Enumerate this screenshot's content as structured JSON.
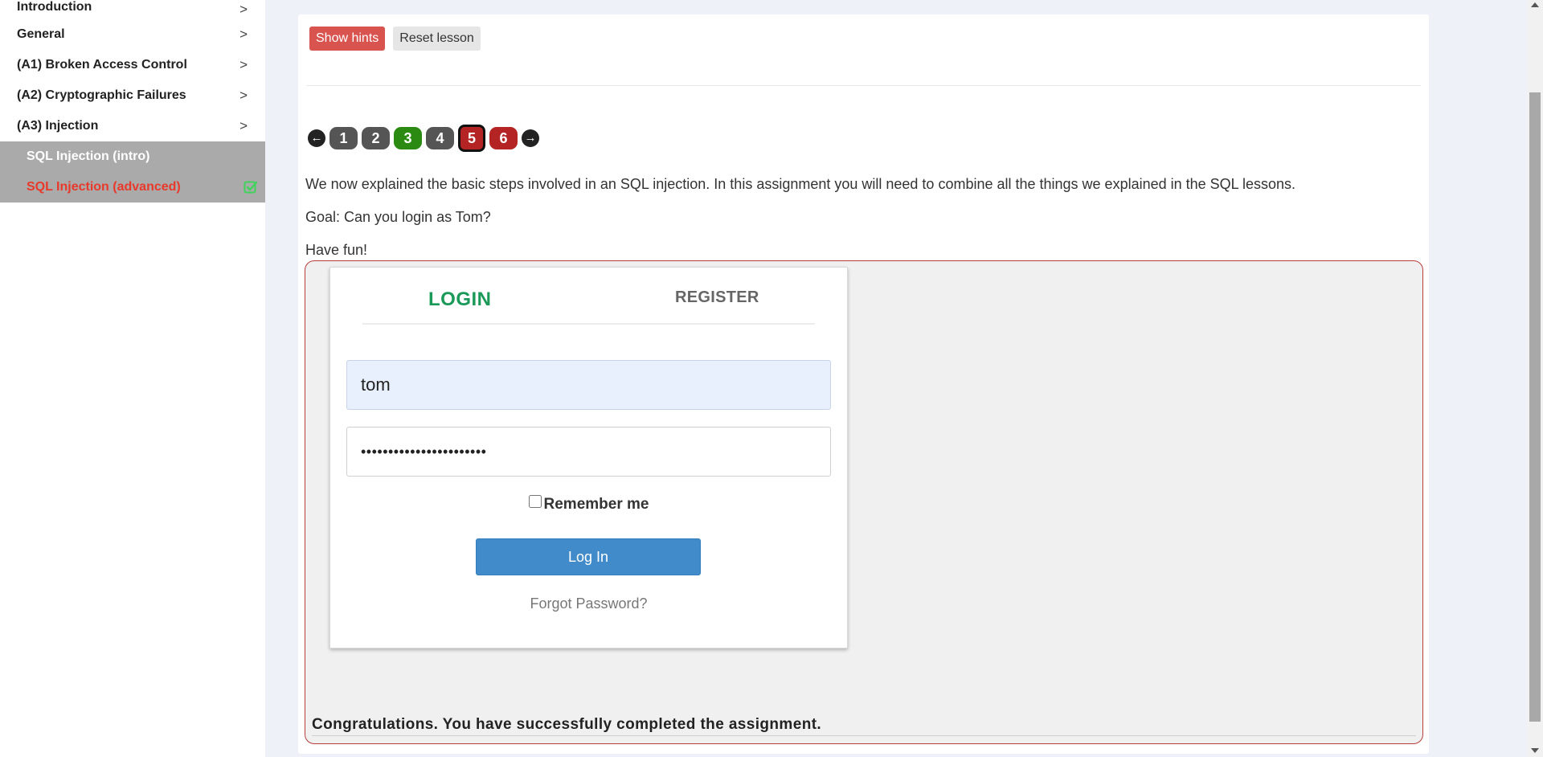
{
  "sidebar": {
    "items": [
      {
        "label": "Introduction"
      },
      {
        "label": "General"
      },
      {
        "label": "(A1) Broken Access Control"
      },
      {
        "label": "(A2) Cryptographic Failures"
      },
      {
        "label": "(A3) Injection"
      }
    ],
    "subitems": [
      {
        "label": "SQL Injection (intro)",
        "active": false
      },
      {
        "label": "SQL Injection (advanced)",
        "active": true,
        "completed": true
      }
    ],
    "chevron": ">"
  },
  "toolbar": {
    "show_hints_label": "Show hints",
    "reset_lesson_label": "Reset lesson"
  },
  "pager": {
    "prev_icon": "arrow-left-icon",
    "next_icon": "arrow-right-icon",
    "pages": [
      {
        "label": "1",
        "state": "gray"
      },
      {
        "label": "2",
        "state": "gray"
      },
      {
        "label": "3",
        "state": "green"
      },
      {
        "label": "4",
        "state": "gray"
      },
      {
        "label": "5",
        "state": "current"
      },
      {
        "label": "6",
        "state": "red"
      }
    ]
  },
  "content": {
    "paragraph1": "We now explained the basic steps involved in an SQL injection. In this assignment you will need to combine all the things we explained in the SQL lessons.",
    "paragraph2": "Goal: Can you login as Tom?",
    "paragraph3": "Have fun!"
  },
  "login_form": {
    "tab_login": "LOGIN",
    "tab_register": "REGISTER",
    "username_value": "tom",
    "password_value": "•••••••••••••••••••••••",
    "remember_label": "Remember me",
    "login_button": "Log In",
    "forgot_link": "Forgot Password?"
  },
  "feedback": {
    "message": "Congratulations. You have successfully completed the assignment."
  },
  "colors": {
    "accent_red": "#d9534f",
    "success_green": "#2b8a12",
    "login_tab_green": "#1a9959",
    "primary_blue": "#428bca"
  }
}
